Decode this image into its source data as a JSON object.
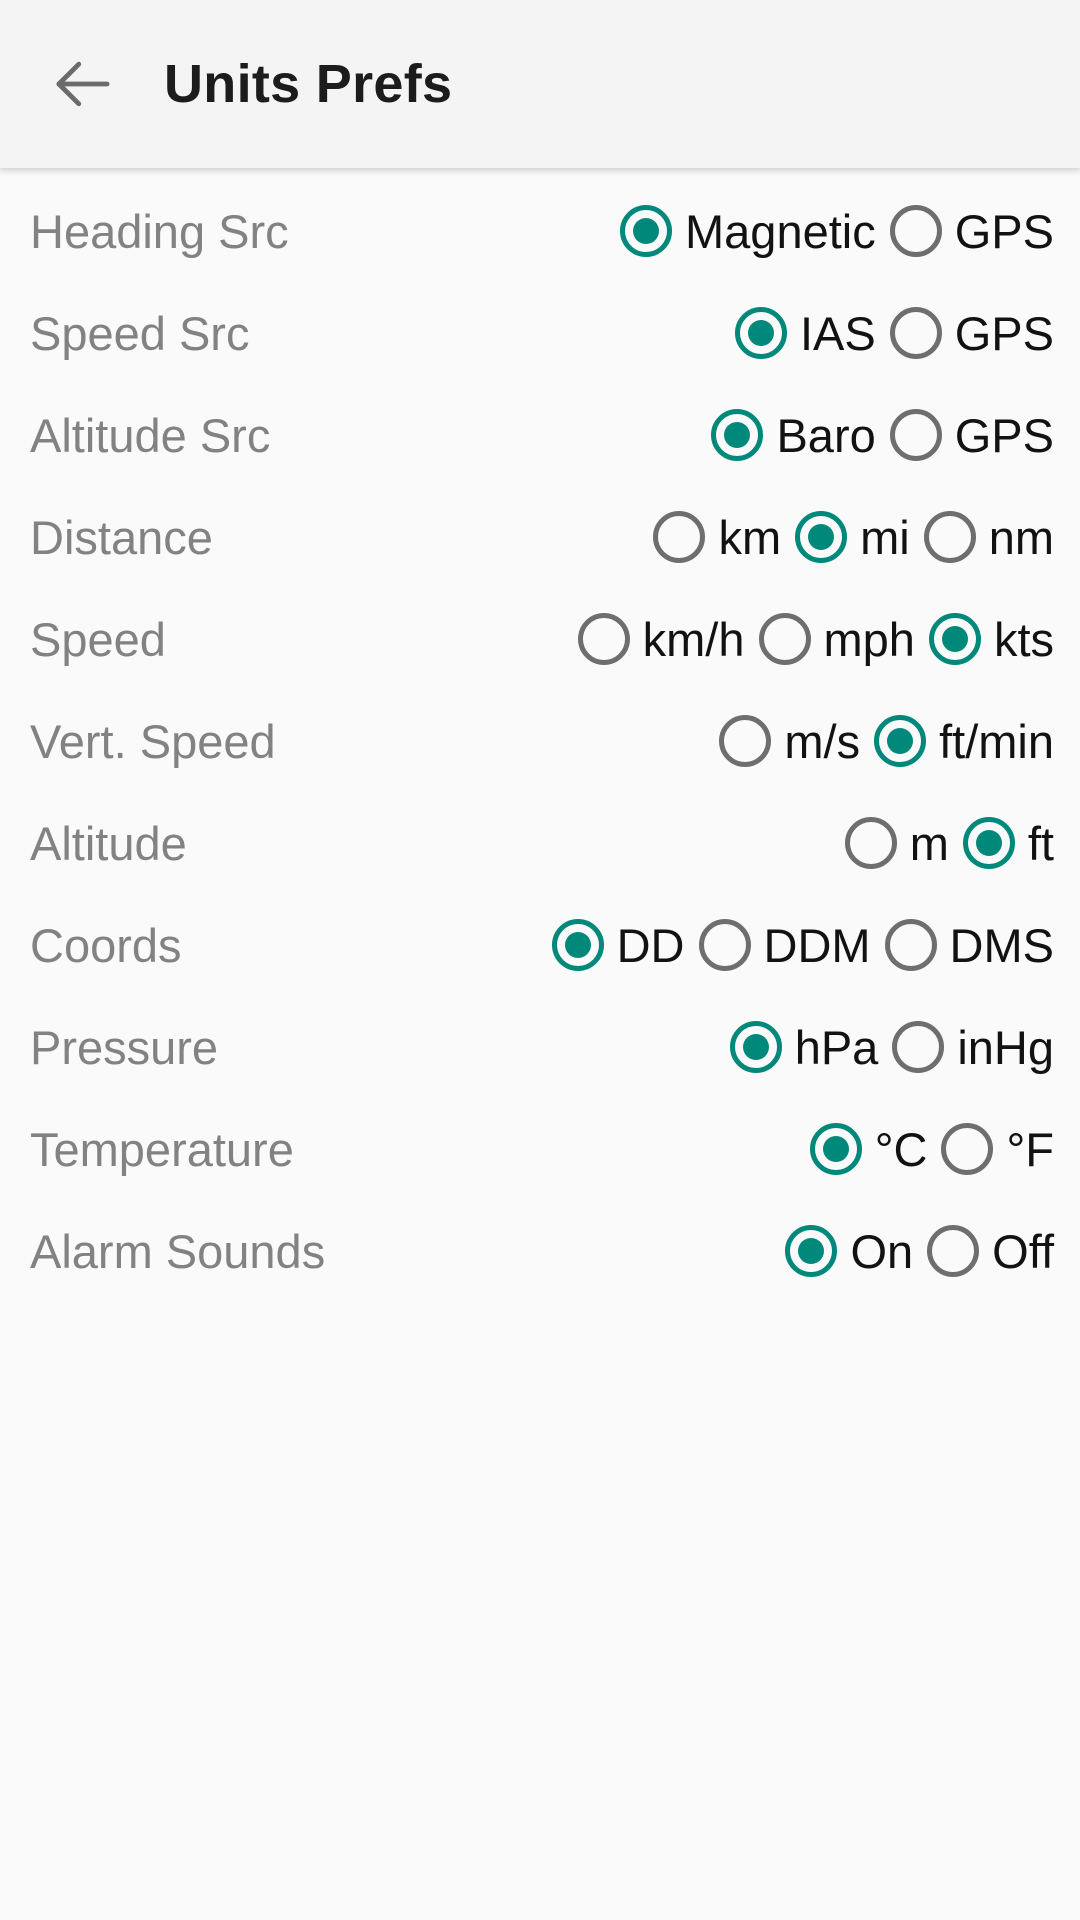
{
  "appbar": {
    "back_icon": "arrow-left-icon",
    "title": "Units Prefs"
  },
  "rows": [
    {
      "label": "Heading Src",
      "options": [
        {
          "label": "Magnetic",
          "selected": true
        },
        {
          "label": "GPS",
          "selected": false
        }
      ]
    },
    {
      "label": "Speed Src",
      "options": [
        {
          "label": "IAS",
          "selected": true
        },
        {
          "label": "GPS",
          "selected": false
        }
      ]
    },
    {
      "label": "Altitude Src",
      "options": [
        {
          "label": "Baro",
          "selected": true
        },
        {
          "label": "GPS",
          "selected": false
        }
      ]
    },
    {
      "label": "Distance",
      "options": [
        {
          "label": "km",
          "selected": false
        },
        {
          "label": "mi",
          "selected": true
        },
        {
          "label": "nm",
          "selected": false
        }
      ]
    },
    {
      "label": "Speed",
      "options": [
        {
          "label": "km/h",
          "selected": false
        },
        {
          "label": "mph",
          "selected": false
        },
        {
          "label": "kts",
          "selected": true
        }
      ]
    },
    {
      "label": "Vert. Speed",
      "options": [
        {
          "label": "m/s",
          "selected": false
        },
        {
          "label": "ft/min",
          "selected": true
        }
      ]
    },
    {
      "label": "Altitude",
      "options": [
        {
          "label": "m",
          "selected": false
        },
        {
          "label": "ft",
          "selected": true
        }
      ]
    },
    {
      "label": "Coords",
      "options": [
        {
          "label": "DD",
          "selected": true
        },
        {
          "label": "DDM",
          "selected": false
        },
        {
          "label": "DMS",
          "selected": false
        }
      ]
    },
    {
      "label": "Pressure",
      "options": [
        {
          "label": "hPa",
          "selected": true
        },
        {
          "label": "inHg",
          "selected": false
        }
      ]
    },
    {
      "label": "Temperature",
      "options": [
        {
          "label": "°C",
          "selected": true
        },
        {
          "label": "°F",
          "selected": false
        }
      ]
    },
    {
      "label": "Alarm Sounds",
      "options": [
        {
          "label": "On",
          "selected": true
        },
        {
          "label": "Off",
          "selected": false
        }
      ]
    }
  ],
  "colors": {
    "accent": "#00897a",
    "label": "#828282",
    "option_text": "#121212",
    "radio_unselected": "#6e6e6e",
    "appbar_bg": "#f4f4f4",
    "page_bg": "#fafafa"
  }
}
